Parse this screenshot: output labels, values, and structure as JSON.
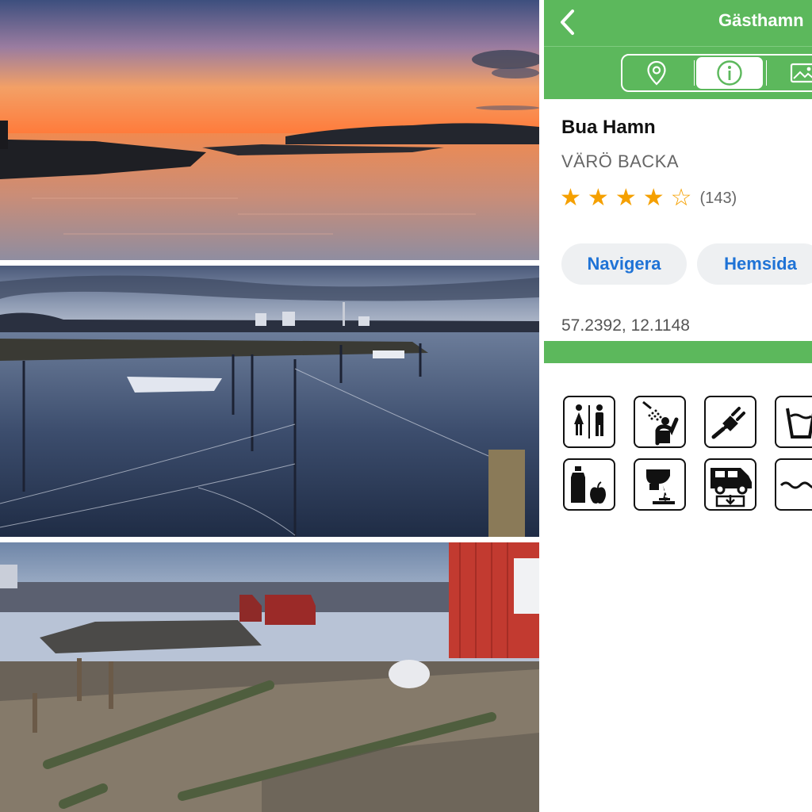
{
  "photos": [
    {
      "name": "sunset-over-water",
      "colors": {
        "sky_top": "#3a4d7a",
        "sky_glow": "#f4a15d",
        "horizon": "#ff7a3a",
        "water": "#c98a6b"
      }
    },
    {
      "name": "marina-at-dusk",
      "colors": {
        "sky": "#5b6d8f",
        "water": "#2f3e5a"
      }
    },
    {
      "name": "rocky-shore-with-red-boathouse",
      "colors": {
        "sky": "#7f95b4",
        "boathouse": "#c0302a"
      }
    }
  ],
  "app": {
    "title": "Gästhamn",
    "accent_color": "#5cb85c",
    "link_color": "#1f73d6",
    "back_icon": "chevron-left-icon",
    "segments": [
      {
        "icon": "map-pin-icon",
        "selected": false
      },
      {
        "icon": "info-icon",
        "selected": true
      },
      {
        "icon": "image-icon",
        "selected": false
      }
    ],
    "place": {
      "name": "Bua Hamn",
      "region": "VÄRÖ BACKA",
      "rating_stars": 4,
      "rating_max": 5,
      "rating_count": "(143)",
      "star_glyphs": [
        "★",
        "★",
        "★",
        "★",
        "☆"
      ]
    },
    "buttons": {
      "navigate": "Navigera",
      "website": "Hemsida"
    },
    "coordinates": "57.2392, 12.1148",
    "amenities": [
      {
        "icon": "toilets-icon"
      },
      {
        "icon": "shower-icon"
      },
      {
        "icon": "electricity-icon"
      },
      {
        "icon": "fresh-water-icon"
      },
      {
        "icon": "grocery-icon"
      },
      {
        "icon": "toilet-emptying-icon"
      },
      {
        "icon": "camper-service-icon"
      },
      {
        "icon": "water-icon"
      }
    ]
  }
}
